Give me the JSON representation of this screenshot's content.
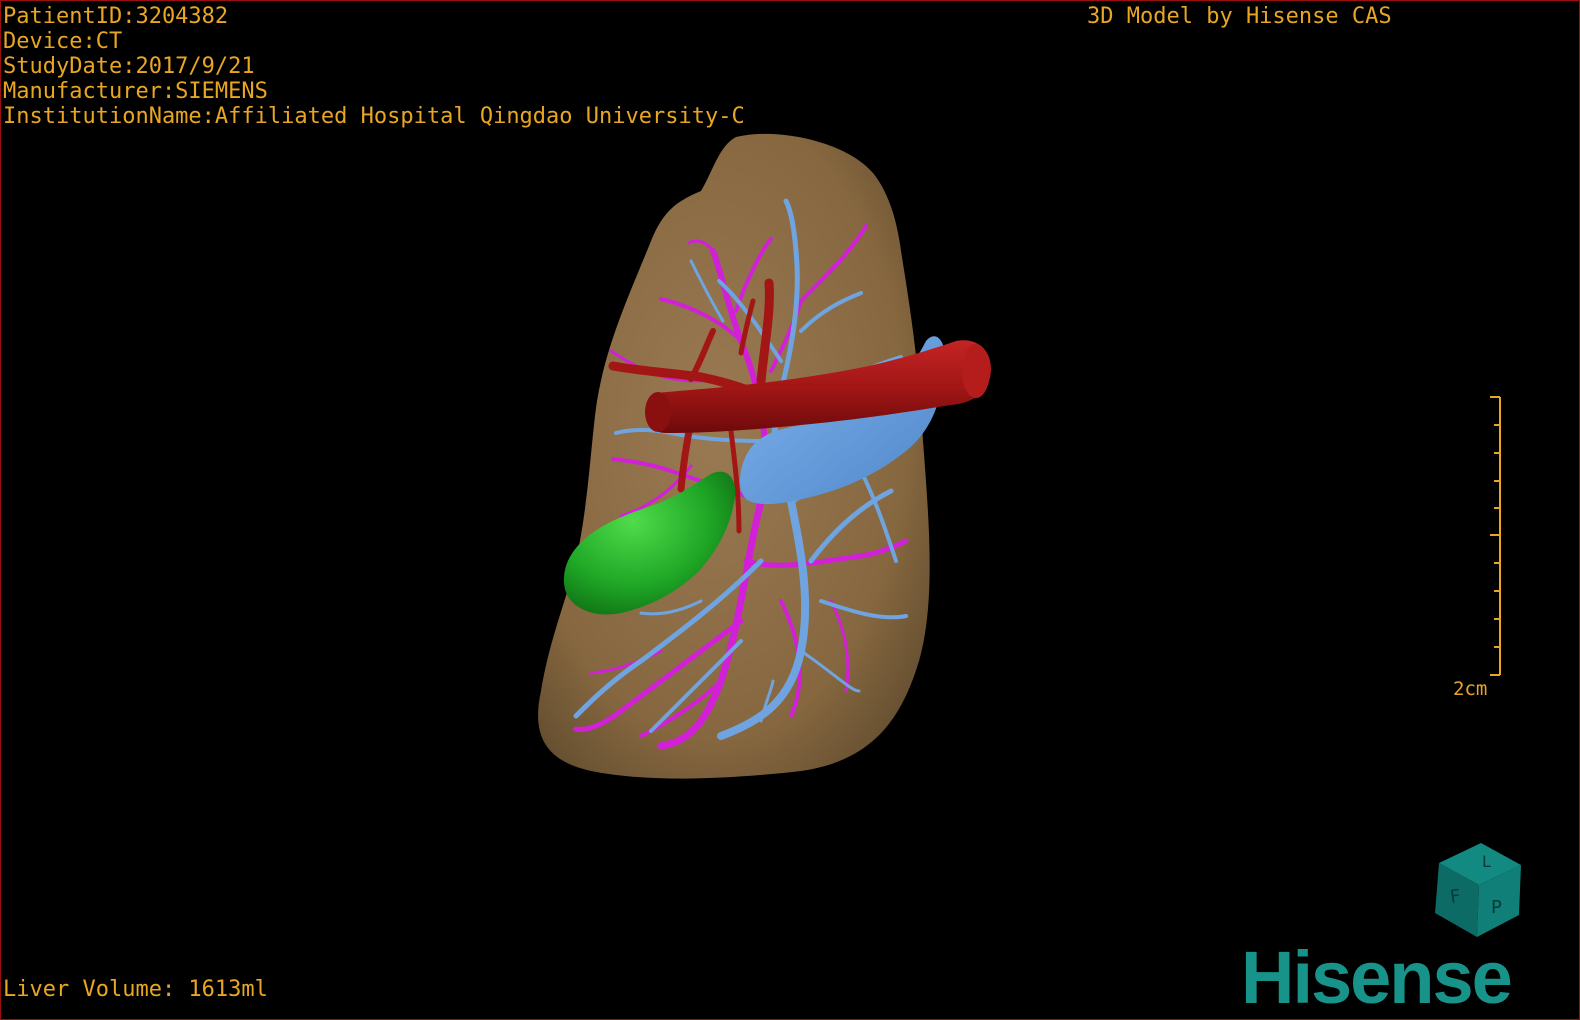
{
  "header": {
    "patient_id": "PatientID:3204382",
    "device": "Device:CT",
    "study_date": "StudyDate:2017/9/21",
    "manufacturer": "Manufacturer:SIEMENS",
    "institution": "InstitutionName:Affiliated Hospital Qingdao University-C",
    "model_credit": "3D Model by Hisense CAS"
  },
  "footer": {
    "liver_volume": "Liver Volume: 1613ml"
  },
  "scale_bar": {
    "label": "2cm"
  },
  "orientation_cube": {
    "face_labels": [
      "F",
      "L",
      "P"
    ]
  },
  "brand": {
    "logo_text": "Hisense"
  },
  "model": {
    "structures": [
      "liver",
      "gallbladder",
      "portal-vein",
      "hepatic-veins",
      "arteries",
      "inferior-vena-cava"
    ],
    "colors": {
      "background": "#000000",
      "overlay_text": "#e8a623",
      "liver": "#8a6c47",
      "gallbladder": "#1fa626",
      "portal_vein": "#6fa4e0",
      "hepatic_vein": "#d21fd8",
      "artery": "#a31616",
      "cube": "#0f7f77",
      "logo": "#17938a",
      "frame_border": "#9a1010"
    }
  }
}
